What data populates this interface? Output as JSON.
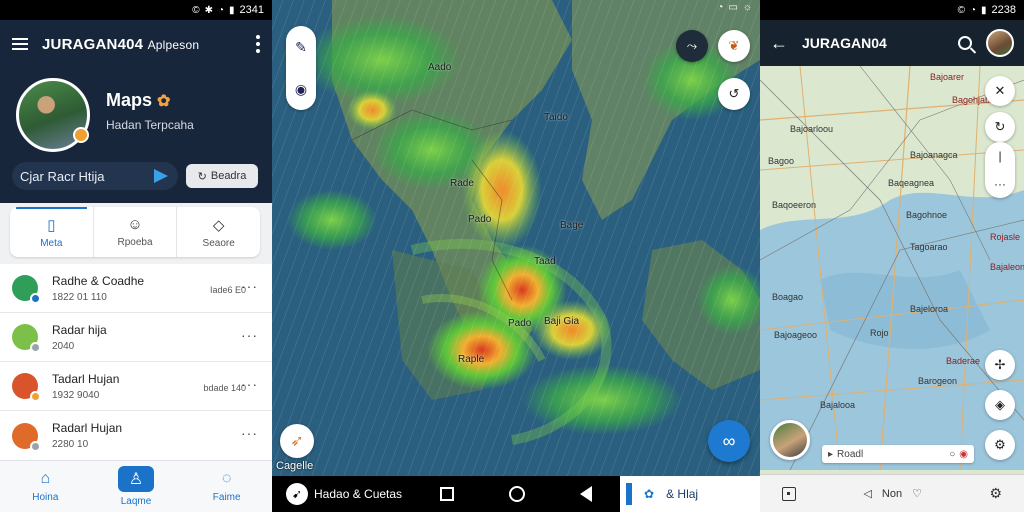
{
  "status1": {
    "time": "2341"
  },
  "status3": {
    "time": "2238"
  },
  "panel1": {
    "title": "JURAGAN404",
    "title_suffix": "Aplpeson",
    "profile_name": "Maps",
    "profile_sub": "Hadan Terpcaha",
    "radar_label": "Cjar Racr Htija",
    "radar_button": "Beadra",
    "tabs": [
      {
        "label": "Meta",
        "icon": "phone-icon"
      },
      {
        "label": "Rpoeba",
        "icon": "user-icon"
      },
      {
        "label": "Seaore",
        "icon": "shield-icon"
      }
    ],
    "list": [
      {
        "title": "Radhe & Coadhe",
        "sub": "1822 01 110",
        "meta": "Iade6 E0",
        "color": "#2e9e58",
        "badge": "#1a73c8"
      },
      {
        "title": "Radar hija",
        "sub": "2040",
        "meta": "",
        "color": "#7cc04a",
        "badge": "#9aa2ab"
      },
      {
        "title": "Tadarl Hujan",
        "sub": "1932 9040",
        "meta": "bdade 140",
        "color": "#d9542a",
        "badge": "#f0a030"
      },
      {
        "title": "Radarl Hujan",
        "sub": "2280 10",
        "meta": "",
        "color": "#e06a2a",
        "badge": "#9aa2ab"
      }
    ],
    "bottom_nav": [
      {
        "label": "Hoina",
        "icon": "home-icon"
      },
      {
        "label": "Laqme",
        "icon": "person-icon"
      },
      {
        "label": "Faime",
        "icon": "chat-icon"
      }
    ]
  },
  "panel2": {
    "map_labels": [
      {
        "text": "Aado"
      },
      {
        "text": "Taido"
      },
      {
        "text": "Rade"
      },
      {
        "text": "Pado"
      },
      {
        "text": "Bage"
      },
      {
        "text": "Taad"
      },
      {
        "text": "Pado"
      },
      {
        "text": "Baji Gia"
      },
      {
        "text": "Raple"
      }
    ],
    "compass_label": "Cagelle",
    "nav_brand": "Hadao & Cuetas",
    "strip_text": "& Hlaj"
  },
  "panel3": {
    "title": "JURAGAN04",
    "map_labels": [
      {
        "text": "Bajoarloou",
        "red": false
      },
      {
        "text": "Bajoarer",
        "red": true
      },
      {
        "text": "Bagohjabe",
        "red": true
      },
      {
        "text": "Bajoanagca",
        "red": false
      },
      {
        "text": "Bagoo",
        "red": false
      },
      {
        "text": "Baqeagnea",
        "red": false
      },
      {
        "text": "Rojasle",
        "red": true
      },
      {
        "text": "Bagohnoe",
        "red": false
      },
      {
        "text": "Baqoeeron",
        "red": false
      },
      {
        "text": "Bajaleon",
        "red": true
      },
      {
        "text": "Tagoarao",
        "red": false
      },
      {
        "text": "Boagao",
        "red": false
      },
      {
        "text": "Bajeloroa",
        "red": false
      },
      {
        "text": "Bajoageoo",
        "red": false
      },
      {
        "text": "Rojo",
        "red": false
      },
      {
        "text": "Baderae",
        "red": true
      },
      {
        "text": "Bajalooa",
        "red": false
      },
      {
        "text": "Barogeon",
        "red": false
      }
    ],
    "input_text": "Roadl",
    "nav_label": "Non"
  }
}
